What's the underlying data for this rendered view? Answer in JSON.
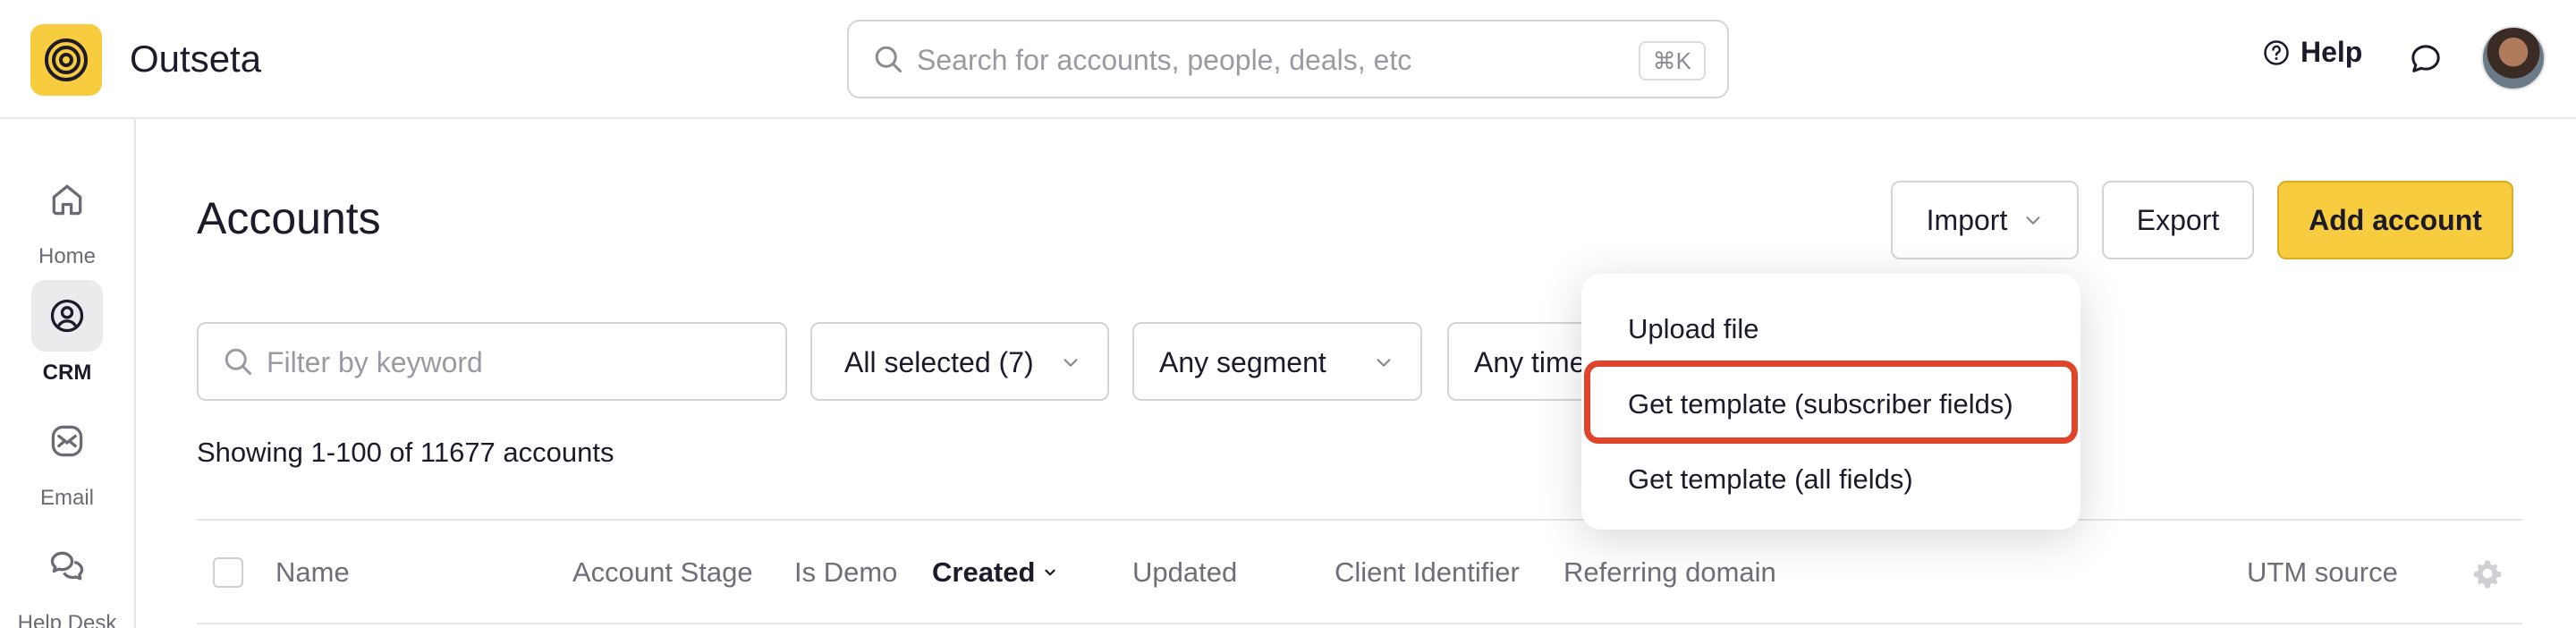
{
  "app": {
    "name": "Outseta"
  },
  "header": {
    "search_placeholder": "Search for accounts, people, deals, etc",
    "search_shortcut": "⌘K",
    "help_label": "Help"
  },
  "sidebar": {
    "items": [
      {
        "label": "Home",
        "icon": "home-icon"
      },
      {
        "label": "CRM",
        "icon": "crm-icon",
        "active": true
      },
      {
        "label": "Email",
        "icon": "email-icon"
      },
      {
        "label": "Help Desk",
        "icon": "help-desk-icon"
      }
    ]
  },
  "main": {
    "title": "Accounts",
    "buttons": {
      "import": "Import",
      "export": "Export",
      "add": "Add account"
    },
    "filters": {
      "keyword_placeholder": "Filter by keyword",
      "stage": "All selected (7)",
      "segment": "Any segment",
      "time": "Any time"
    },
    "showing": "Showing 1-100 of 11677 accounts",
    "columns": [
      "Name",
      "Account Stage",
      "Is Demo",
      "Created",
      "Updated",
      "Client Identifier",
      "Referring domain",
      "UTM source"
    ]
  },
  "import_menu": {
    "items": [
      "Upload file",
      "Get template (subscriber fields)",
      "Get template (all fields)"
    ],
    "highlight_color": "#e0442a"
  },
  "colors": {
    "accent": "#f7cc3f"
  }
}
